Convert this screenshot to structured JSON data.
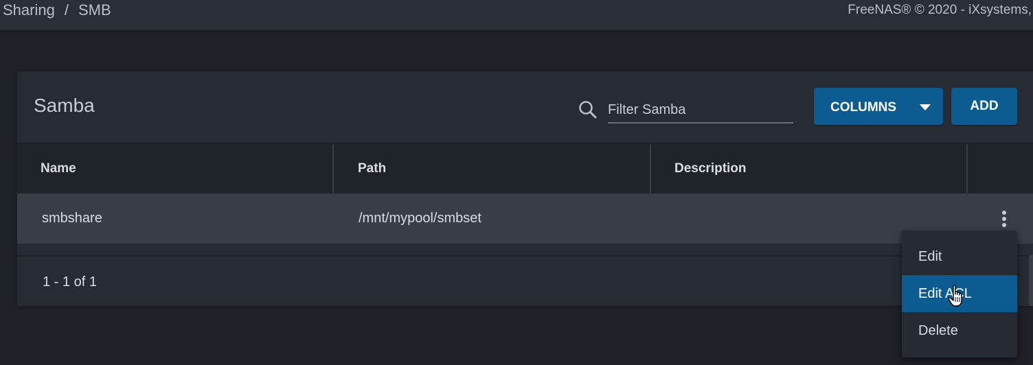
{
  "breadcrumb": {
    "part1": "Sharing",
    "separator": "/",
    "part2": "SMB"
  },
  "copyright": "FreeNAS® © 2020 - iXsystems,",
  "card": {
    "title": "Samba",
    "filter_placeholder": "Filter Samba",
    "columns_label": "COLUMNS",
    "add_label": "ADD"
  },
  "table": {
    "headers": [
      "Name",
      "Path",
      "Description"
    ],
    "rows": [
      {
        "name": "smbshare",
        "path": "/mnt/mypool/smbset",
        "description": ""
      }
    ]
  },
  "pagination": "1 - 1 of 1",
  "context_menu": {
    "items": [
      "Edit",
      "Edit ACL",
      "Delete"
    ],
    "highlighted": "Edit ACL"
  },
  "colors": {
    "accent": "#0d5c91",
    "background": "#1e2127",
    "card": "#272c34"
  },
  "icons": {
    "search": "search-icon",
    "menu": "more-vert-icon",
    "caret": "caret-down-icon",
    "cursor": "hand-pointer-icon"
  }
}
